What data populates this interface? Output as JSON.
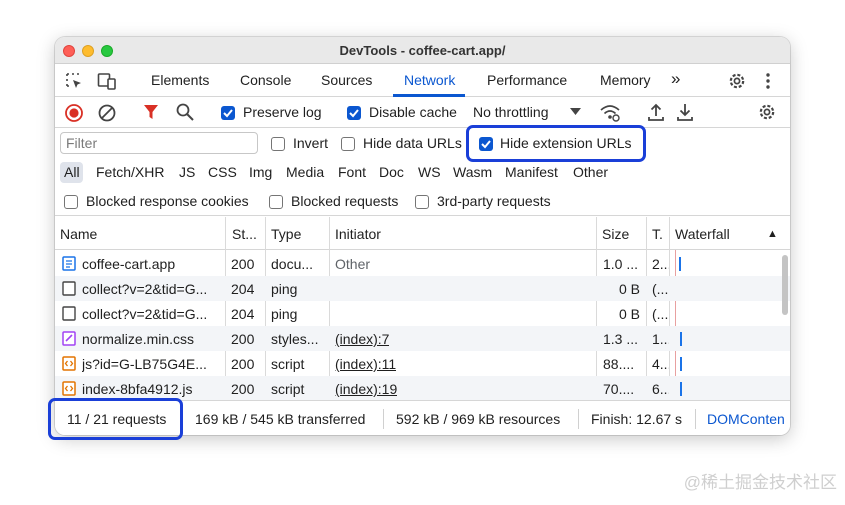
{
  "window": {
    "title": "DevTools - coffee-cart.app/"
  },
  "tabs": [
    "Elements",
    "Console",
    "Sources",
    "Network",
    "Performance",
    "Memory"
  ],
  "active_tab": "Network",
  "more_tabs_glyph": "»",
  "toolbar": {
    "preserve_log": {
      "label": "Preserve log",
      "checked": true
    },
    "disable_cache": {
      "label": "Disable cache",
      "checked": true
    },
    "throttling": "No throttling"
  },
  "filter": {
    "placeholder": "Filter",
    "invert": {
      "label": "Invert",
      "checked": false
    },
    "hide_data_urls": {
      "label": "Hide data URLs",
      "checked": false
    },
    "hide_extension_urls": {
      "label": "Hide extension URLs",
      "checked": true
    }
  },
  "types": [
    "All",
    "Fetch/XHR",
    "JS",
    "CSS",
    "Img",
    "Media",
    "Font",
    "Doc",
    "WS",
    "Wasm",
    "Manifest",
    "Other"
  ],
  "blocking": {
    "blocked_cookies": "Blocked response cookies",
    "blocked_requests": "Blocked requests",
    "third_party": "3rd-party requests"
  },
  "table": {
    "headers": [
      "Name",
      "St...",
      "Type",
      "Initiator",
      "Size",
      "T.",
      "Waterfall"
    ],
    "sort_glyph": "▲",
    "rows": [
      {
        "icon": "document-icon",
        "name": "coffee-cart.app",
        "status": "200",
        "type": "docu...",
        "initiator": "Other",
        "size": "1.0 ...",
        "time": "2..."
      },
      {
        "icon": "blank-file-icon",
        "name": "collect?v=2&tid=G...",
        "status": "204",
        "type": "ping",
        "initiator": "",
        "size": "0 B",
        "time": "(..."
      },
      {
        "icon": "blank-file-icon",
        "name": "collect?v=2&tid=G...",
        "status": "204",
        "type": "ping",
        "initiator": "",
        "size": "0 B",
        "time": "(..."
      },
      {
        "icon": "stylesheet-icon",
        "name": "normalize.min.css",
        "status": "200",
        "type": "styles...",
        "initiator": "(index):7",
        "size": "1.3 ...",
        "time": "1..."
      },
      {
        "icon": "script-icon",
        "name": "js?id=G-LB75G4E...",
        "status": "200",
        "type": "script",
        "initiator": "(index):11",
        "size": "88....",
        "time": "4..."
      },
      {
        "icon": "script-icon",
        "name": "index-8bfa4912.js",
        "status": "200",
        "type": "script",
        "initiator": "(index):19",
        "size": "70....",
        "time": "6..."
      }
    ]
  },
  "status": {
    "requests": "11 / 21 requests",
    "transferred": "169 kB / 545 kB transferred",
    "resources": "592 kB / 969 kB resources",
    "finish": "Finish: 12.67 s",
    "domcontent": "DOMConten"
  },
  "colors": {
    "accent": "#0b57d0",
    "highlight": "#1a3fd8",
    "record_red": "#d93025"
  },
  "watermark": "@稀土掘金技术社区"
}
